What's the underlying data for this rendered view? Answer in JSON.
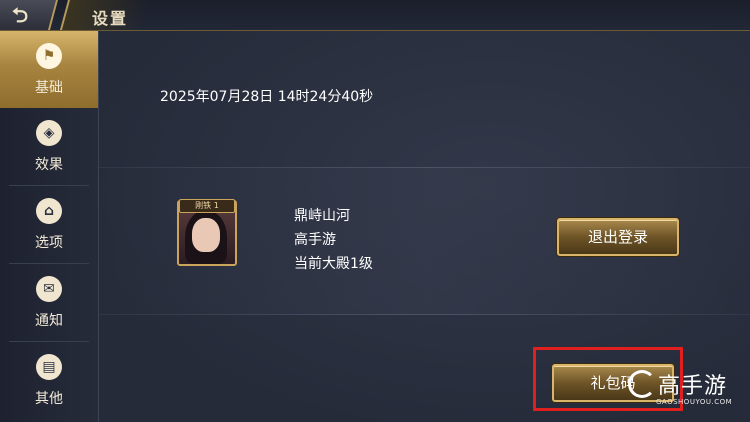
{
  "header": {
    "title": "设置",
    "back_icon": "back-arrow-icon"
  },
  "sidebar": {
    "items": [
      {
        "label": "基础",
        "icon": "flag-icon",
        "active": true
      },
      {
        "label": "效果",
        "icon": "effect-icon",
        "active": false
      },
      {
        "label": "选项",
        "icon": "palace-icon",
        "active": false
      },
      {
        "label": "通知",
        "icon": "notice-icon",
        "active": false
      },
      {
        "label": "其他",
        "icon": "cards-icon",
        "active": false
      }
    ]
  },
  "main": {
    "datetime": "2025年07月28日 14时24分40秒",
    "profile": {
      "avatar_badge": "刚铁 1",
      "server": "鼎峙山河",
      "name": "高手游",
      "level": "当前大殿1级"
    },
    "logout_button": "退出登录",
    "gift_button": "礼包码"
  },
  "watermark": {
    "brand": "高手游",
    "url": "GAOSHOUYOU.COM"
  },
  "colors": {
    "accent_gold": "#d8b56a",
    "highlight_red": "#e0201e",
    "background": "#2a2f40"
  }
}
